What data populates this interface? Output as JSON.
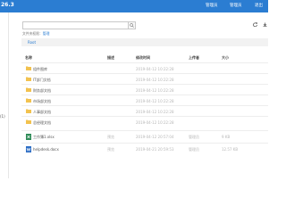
{
  "header": {
    "title": "26.3",
    "links": [
      "管理员",
      "管理员",
      "退出"
    ]
  },
  "sidebar": {
    "tag": "(1)"
  },
  "search": {
    "value": "",
    "placeholder": ""
  },
  "size_info": {
    "label": "文件夹权限：",
    "link": "管理"
  },
  "breadcrumb": {
    "root": "Root"
  },
  "table": {
    "headers": [
      "名称",
      "描述",
      "修改时间",
      "上传者",
      "大小"
    ],
    "rows": [
      {
        "icon": "folder-icon",
        "name": "组件图库",
        "desc": "",
        "date": "2019-04-12 10:22:28",
        "uploader": "",
        "size": ""
      },
      {
        "icon": "folder-icon",
        "name": "IT部门文档",
        "desc": "",
        "date": "2019-04-12 10:22:28",
        "uploader": "",
        "size": ""
      },
      {
        "icon": "folder-icon",
        "name": "财务部文档",
        "desc": "",
        "date": "2019-04-12 10:22:28",
        "uploader": "",
        "size": ""
      },
      {
        "icon": "folder-icon",
        "name": "市场部文档",
        "desc": "",
        "date": "2019-04-12 10:22:28",
        "uploader": "",
        "size": ""
      },
      {
        "icon": "folder-icon",
        "name": "人事部文档",
        "desc": "",
        "date": "2019-04-12 10:22:28",
        "uploader": "",
        "size": ""
      },
      {
        "icon": "folder-icon",
        "name": "总经理文档",
        "desc": "",
        "date": "2019-04-12 10:22:28",
        "uploader": "",
        "size": ""
      },
      {
        "icon": "excel-icon",
        "name": "工作簿1.xlsx",
        "desc": "预览",
        "date": "2019-04-12 20:57:04",
        "uploader": "管理员",
        "size": "9 KB"
      },
      {
        "icon": "word-icon",
        "name": "helpdesk.docx",
        "desc": "预览",
        "date": "2019-04-21 20:59:53",
        "uploader": "管理员",
        "size": "12.57 KB"
      }
    ]
  },
  "colors": {
    "header_bg": "#2b7dd2",
    "folder": "#f2c24f",
    "excel": "#2e8b57",
    "word": "#2b6cc4"
  }
}
